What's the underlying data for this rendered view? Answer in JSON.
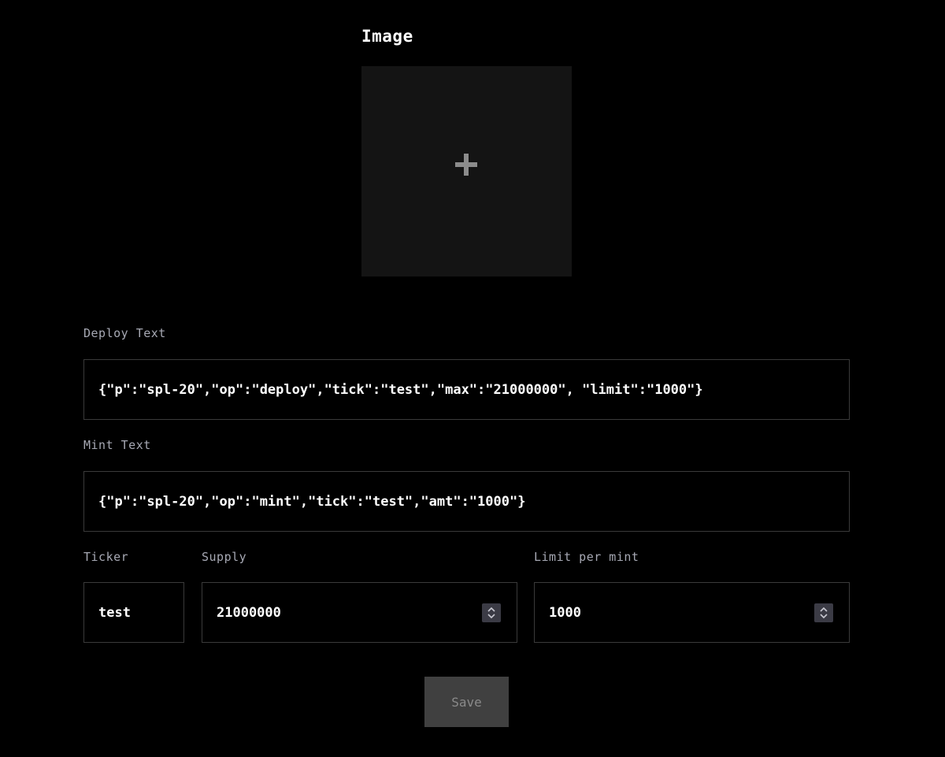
{
  "image_section": {
    "title": "Image",
    "upload_icon": "plus-icon"
  },
  "deploy": {
    "label": "Deploy Text",
    "value": "{\"p\":\"spl-20\",\"op\":\"deploy\",\"tick\":\"test\",\"max\":\"21000000\", \"limit\":\"1000\"}"
  },
  "mint": {
    "label": "Mint Text",
    "value": "{\"p\":\"spl-20\",\"op\":\"mint\",\"tick\":\"test\",\"amt\":\"1000\"}"
  },
  "ticker": {
    "label": "Ticker",
    "value": "test"
  },
  "supply": {
    "label": "Supply",
    "value": "21000000"
  },
  "limit": {
    "label": "Limit per mint",
    "value": "1000"
  },
  "save": {
    "label": "Save"
  },
  "colors": {
    "background": "#000000",
    "label": "#a7a9b4",
    "field_border": "#3a3a3a",
    "button_bg": "#404040",
    "button_text": "#8a8a8a"
  }
}
